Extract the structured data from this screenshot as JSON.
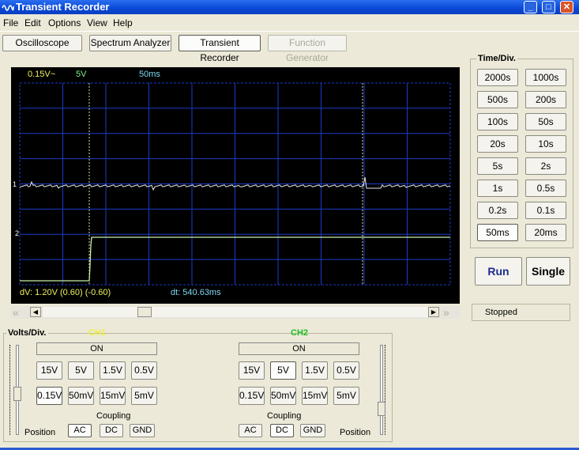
{
  "window": {
    "title": "Transient Recorder"
  },
  "menu": [
    "File",
    "Edit",
    "Options",
    "View",
    "Help"
  ],
  "tabs": [
    {
      "label": "Oscilloscope",
      "state": "normal"
    },
    {
      "label": "Spectrum Analyzer",
      "state": "normal"
    },
    {
      "label": "Transient Recorder",
      "state": "selected"
    },
    {
      "label": "Function Generator",
      "state": "disabled"
    }
  ],
  "scope": {
    "ch1_scale": "0.15V~",
    "ch2_scale": "5V",
    "time_scale": "50ms",
    "marker_1": "1",
    "marker_2": "2",
    "dv": "dV: 1.20V  (0.60) (-0.60)",
    "dt": "dt: 540.63ms",
    "colors": {
      "bg": "#000000",
      "grid": "#1a3cc8",
      "cursor": "#d8e8a0",
      "trace1": "#e8e8e8",
      "trace2": "#c8f0a8",
      "text_yellow": "#f0f060",
      "text_green": "#80f080",
      "text_cyan": "#80d8f0"
    }
  },
  "time_div": {
    "label": "Time/Div.",
    "buttons": [
      [
        "2000s",
        "1000s"
      ],
      [
        "500s",
        "200s"
      ],
      [
        "100s",
        "50s"
      ],
      [
        "20s",
        "10s"
      ],
      [
        "5s",
        "2s"
      ],
      [
        "1s",
        "0.5s"
      ],
      [
        "0.2s",
        "0.1s"
      ],
      [
        "50ms",
        "20ms"
      ]
    ],
    "selected": "50ms"
  },
  "run_label": "Run",
  "single_label": "Single",
  "status": "Stopped",
  "volts": {
    "label": "Volts/Div.",
    "position_label": "Position",
    "coupling_label": "Coupling",
    "ch1": {
      "name": "CH1",
      "color": "#f0f040",
      "on_label": "ON",
      "rows": [
        [
          "15V",
          "5V",
          "1.5V",
          "0.5V"
        ],
        [
          "0.15V",
          "50mV",
          "15mV",
          "5mV"
        ]
      ],
      "selected": "0.15V",
      "coupling": [
        "AC",
        "DC",
        "GND"
      ],
      "coupling_selected": "AC"
    },
    "ch2": {
      "name": "CH2",
      "color": "#20c020",
      "on_label": "ON",
      "rows": [
        [
          "15V",
          "5V",
          "1.5V",
          "0.5V"
        ],
        [
          "0.15V",
          "50mV",
          "15mV",
          "5mV"
        ]
      ],
      "selected": "5V",
      "coupling": [
        "AC",
        "DC",
        "GND"
      ],
      "coupling_selected": "DC"
    }
  }
}
